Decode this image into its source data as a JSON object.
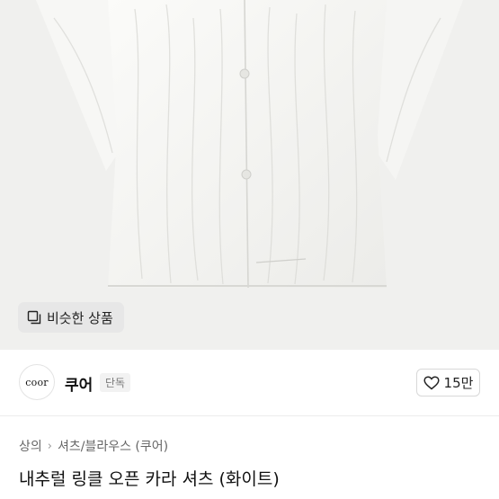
{
  "product_image": {
    "similar_button_label": "비슷한 상품",
    "similar_icon": "similar-products-icon"
  },
  "brand": {
    "logo_text": "coor",
    "name": "쿠어",
    "badge": "단독"
  },
  "like": {
    "icon": "heart-outline-icon",
    "count": "15만"
  },
  "breadcrumb": {
    "items": [
      "상의",
      "셔츠/블라우스 (쿠어)"
    ],
    "separator": "›"
  },
  "product": {
    "title": "내추럴 링클 오픈 카라 셔츠 (화이트)"
  }
}
